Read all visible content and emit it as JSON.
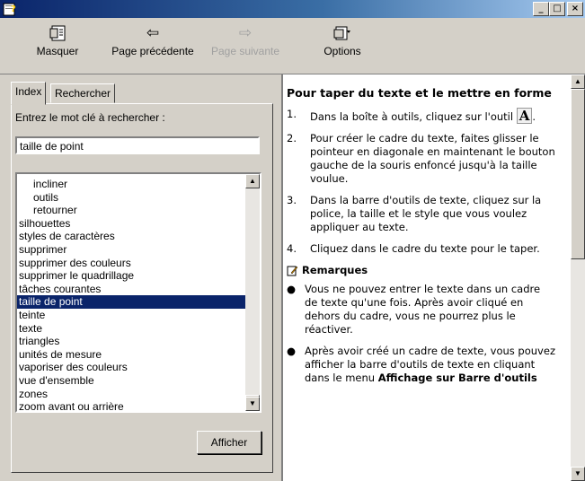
{
  "window": {
    "minimize": "_",
    "maximize": "□",
    "close": "×"
  },
  "toolbar": {
    "hide_label": "Masquer",
    "back_label": "Page précédente",
    "forward_label": "Page suivante",
    "options_label": "Options"
  },
  "left": {
    "tab_index": "Index",
    "tab_search": "Rechercher",
    "prompt": "Entrez le mot clé à rechercher :",
    "search_value": "taille de point",
    "items": [
      {
        "label": "incliner",
        "sub": true
      },
      {
        "label": "outils",
        "sub": true
      },
      {
        "label": "retourner",
        "sub": true
      },
      {
        "label": "silhouettes",
        "sub": false
      },
      {
        "label": "styles de caractères",
        "sub": false
      },
      {
        "label": "supprimer",
        "sub": false
      },
      {
        "label": "supprimer des couleurs",
        "sub": false
      },
      {
        "label": "supprimer le quadrillage",
        "sub": false
      },
      {
        "label": "tâches courantes",
        "sub": false
      },
      {
        "label": "taille de point",
        "sub": false,
        "selected": true
      },
      {
        "label": "teinte",
        "sub": false
      },
      {
        "label": "texte",
        "sub": false
      },
      {
        "label": "triangles",
        "sub": false
      },
      {
        "label": "unités de mesure",
        "sub": false
      },
      {
        "label": "vaporiser des couleurs",
        "sub": false
      },
      {
        "label": "vue d'ensemble",
        "sub": false
      },
      {
        "label": "zones",
        "sub": false
      },
      {
        "label": "zoom avant ou arrière",
        "sub": false
      }
    ],
    "display_button": "Afficher"
  },
  "content": {
    "title": "Pour taper du texte et le mettre en forme",
    "steps": [
      {
        "n": "1.",
        "text_a": "Dans la boîte à outils, cliquez sur l'outil",
        "icon": "A",
        "text_b": "."
      },
      {
        "n": "2.",
        "text": "Pour créer le cadre du texte, faites glisser le pointeur en diagonale en maintenant le bouton gauche de la souris enfoncé jusqu'à la taille voulue."
      },
      {
        "n": "3.",
        "text": "Dans la barre d'outils de texte, cliquez sur la police, la taille et le style que vous voulez appliquer au texte."
      },
      {
        "n": "4.",
        "text": "Cliquez dans le cadre du texte pour le taper."
      }
    ],
    "notes_title": "Remarques",
    "notes": [
      "Vous ne pouvez entrer le texte dans un cadre de texte qu'une fois. Après avoir cliqué en dehors du cadre, vous ne pourrez plus le réactiver.",
      "Après avoir créé un cadre de texte, vous pouvez afficher la barre d'outils de texte en cliquant dans le menu"
    ],
    "cutoff": "Affichage sur Barre d'outils"
  },
  "colors": {
    "selection": "#0a246a",
    "face": "#d4d0c8"
  }
}
